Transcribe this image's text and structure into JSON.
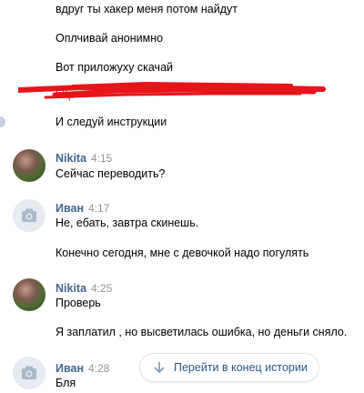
{
  "messages_top": {
    "line1": "вдруг ты хакер меня потом найдут",
    "line2": "Оплчивай анонимно",
    "line3": "Вот приложуху скачай",
    "line4_partial": "http",
    "line5": "И следуй инструкции"
  },
  "group_nikita_1": {
    "name": "Nikita",
    "time": "4:15",
    "text": "Сейчас переводить?"
  },
  "group_ivan_1": {
    "name": "Иван",
    "time": "4:17",
    "text1": "Не, ебать, завтра скинешь.",
    "text2": "Конечно сегодня, мне с девочкой надо погулять"
  },
  "group_nikita_2": {
    "name": "Nikita",
    "time": "4:25",
    "text1": "Проверь",
    "text2": "Я заплатил , но высветилась ошибка, но деньги сняло."
  },
  "group_ivan_2": {
    "name": "Иван",
    "time": "4:28",
    "text": "Бля"
  },
  "history_button": {
    "label": "Перейти в конец истории",
    "icon": "arrow-down-icon"
  },
  "colors": {
    "name": "#42648b",
    "time": "#939393",
    "link": "#2a5885",
    "redaction": "#e8141b"
  }
}
